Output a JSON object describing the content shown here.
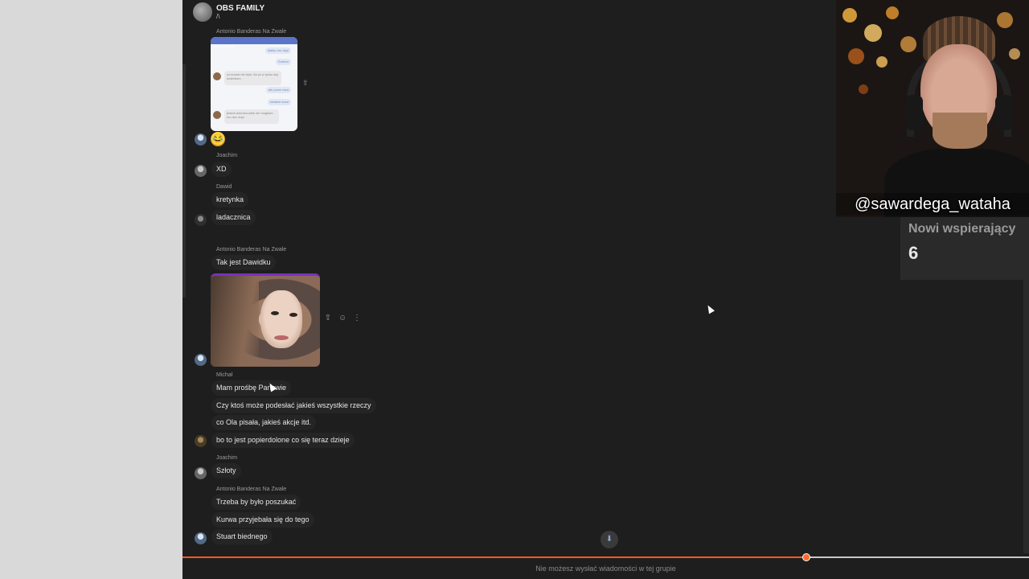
{
  "chat": {
    "title": "OBS FAMILY",
    "subtitle": "/\\"
  },
  "screenshot_message": {
    "sender": "Antonio Banderas Na Zwale",
    "header": "Ola Asiaaa.am",
    "right1": "dlatso mu dupi",
    "right2": "Eurtem",
    "left1": "no kurwa nie bylo. kiz ja w tyzko w/p krdzebom",
    "right3": "ale przez raza",
    "right4": "cielaem sosu",
    "left2": "jedem dzindza wiek nie mogliom mu doc dupi"
  },
  "messages": [
    {
      "sender": "Joachim",
      "text": "XD"
    },
    {
      "sender": "Dawid",
      "texts": [
        "kretynka",
        "ladacznica"
      ]
    },
    {
      "sender": "Antonio Banderas Na Zwale",
      "text": "Tak jest Dawidku"
    },
    {
      "sender": "Michał",
      "texts": [
        "Mam prośbę Panowie",
        "Czy ktoś może podesłać jakieś wszystkie rzeczy",
        "co Ola pisała, jakieś akcje itd.",
        "bo to jest popierdolone co się teraz dzieje"
      ]
    },
    {
      "sender": "Joachim",
      "text": "Szłoty"
    },
    {
      "sender": "Antonio Banderas Na Zwale",
      "texts": [
        "Trzeba by było poszukać",
        "Kurwa przyjebała się do tego",
        "Stuart biednego"
      ]
    }
  ],
  "icons": {
    "share": "share-icon",
    "react": "smiley-icon",
    "more": "more-vertical-icon",
    "scroll_down": "arrow-down-icon"
  },
  "footer": {
    "notice": "Nie możesz wysłać wiadomości w tej grupie",
    "video_progress": 0.737
  },
  "webcam": {
    "handle": "@sawardega_wataha"
  },
  "supporters": {
    "label": "Nowi wspierający",
    "value": "6"
  },
  "colors": {
    "chat_bg": "#1e1e1e",
    "bubble_bg": "#252525",
    "progress": "#ff5a1e"
  }
}
